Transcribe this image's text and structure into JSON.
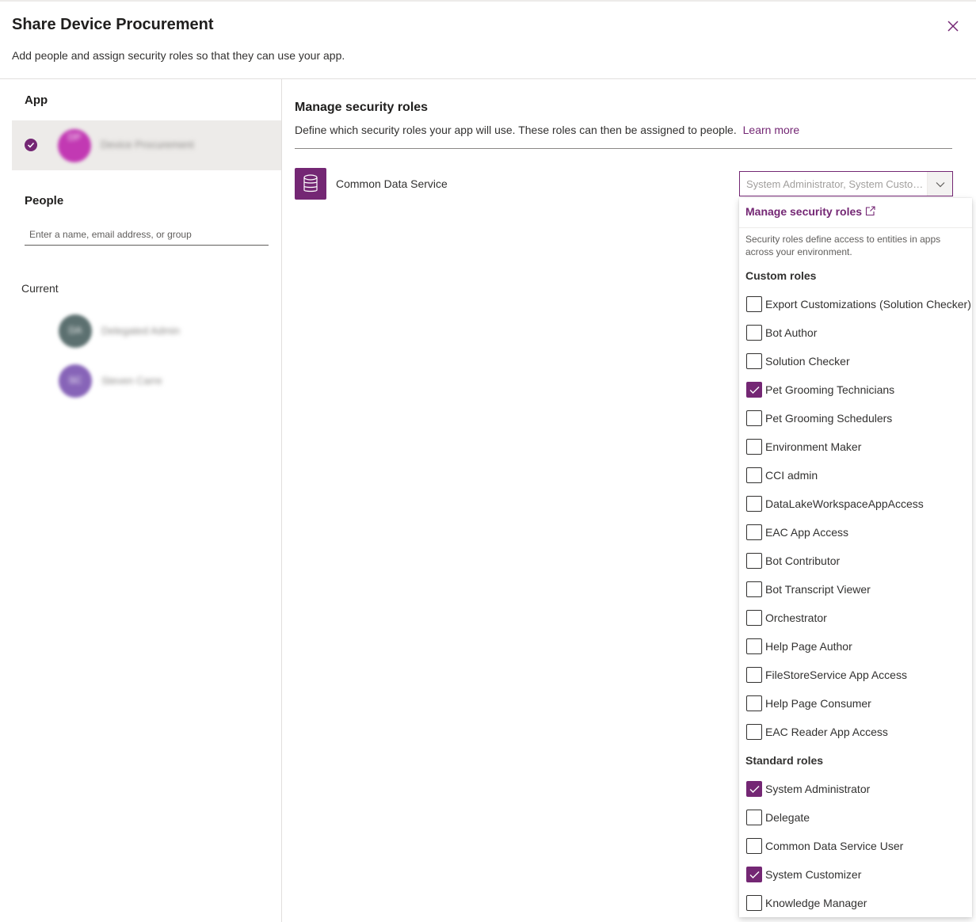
{
  "dialog": {
    "title": "Share Device Procurement",
    "subtitle": "Add people and assign security roles so that they can use your app.",
    "close_icon": "close-icon"
  },
  "left_pane": {
    "app_label": "App",
    "app": {
      "name": "Device Procurement",
      "initials": "DP",
      "selected": true,
      "avatar_color": "#c239b3"
    },
    "people_label": "People",
    "people_input": {
      "placeholder": "Enter a name, email address, or group",
      "value": ""
    },
    "current_label": "Current",
    "current_users": [
      {
        "name": "Delegated Admin",
        "initials": "DA",
        "avatar_color": "#5c7070"
      },
      {
        "name": "Steven Carre",
        "initials": "SC",
        "avatar_color": "#8764b8"
      }
    ]
  },
  "main": {
    "title": "Manage security roles",
    "description": "Define which security roles your app will use. These roles can then be assigned to people.",
    "learn_more": "Learn more",
    "data_source": {
      "label": "Common Data Service",
      "icon": "database-icon",
      "selected_summary": "System Administrator, System Customizer, Pet Grooming Technicians"
    }
  },
  "dropdown": {
    "manage_link": "Manage security roles",
    "manage_link_icon": "open-in-new-window-icon",
    "description": "Security roles define access to entities in apps across your environment.",
    "custom_header": "Custom roles",
    "custom_roles": [
      {
        "label": "Export Customizations (Solution Checker)",
        "checked": false
      },
      {
        "label": "Bot Author",
        "checked": false
      },
      {
        "label": "Solution Checker",
        "checked": false
      },
      {
        "label": "Pet Grooming Technicians",
        "checked": true
      },
      {
        "label": "Pet Grooming Schedulers",
        "checked": false
      },
      {
        "label": "Environment Maker",
        "checked": false
      },
      {
        "label": "CCI admin",
        "checked": false
      },
      {
        "label": "DataLakeWorkspaceAppAccess",
        "checked": false
      },
      {
        "label": "EAC App Access",
        "checked": false
      },
      {
        "label": "Bot Contributor",
        "checked": false
      },
      {
        "label": "Bot Transcript Viewer",
        "checked": false
      },
      {
        "label": "Orchestrator",
        "checked": false
      },
      {
        "label": "Help Page Author",
        "checked": false
      },
      {
        "label": "FileStoreService App Access",
        "checked": false
      },
      {
        "label": "Help Page Consumer",
        "checked": false
      },
      {
        "label": "EAC Reader App Access",
        "checked": false
      }
    ],
    "standard_header": "Standard roles",
    "standard_roles": [
      {
        "label": "System Administrator",
        "checked": true
      },
      {
        "label": "Delegate",
        "checked": false
      },
      {
        "label": "Common Data Service User",
        "checked": false
      },
      {
        "label": "System Customizer",
        "checked": true
      },
      {
        "label": "Knowledge Manager",
        "checked": false
      }
    ]
  },
  "theme": {
    "accent": "#742774"
  }
}
